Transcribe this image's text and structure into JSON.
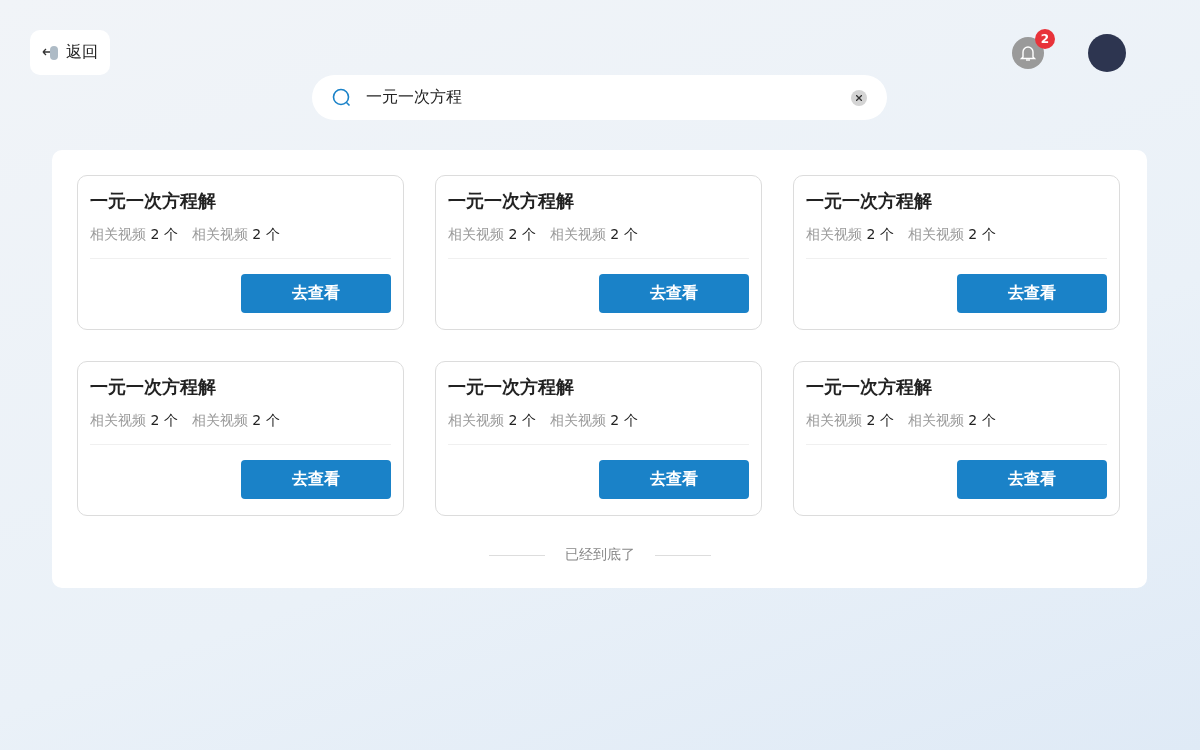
{
  "back_button": {
    "label": "返回"
  },
  "notifications": {
    "badge": "2"
  },
  "search": {
    "value": "一元一次方程"
  },
  "cards": [
    {
      "title": "一元一次方程解",
      "stats": [
        {
          "label": "相关视频",
          "count": "2 个"
        },
        {
          "label": "相关视频",
          "count": "2 个"
        }
      ],
      "button": "去查看"
    },
    {
      "title": "一元一次方程解",
      "stats": [
        {
          "label": "相关视频",
          "count": "2 个"
        },
        {
          "label": "相关视频",
          "count": "2 个"
        }
      ],
      "button": "去查看"
    },
    {
      "title": "一元一次方程解",
      "stats": [
        {
          "label": "相关视频",
          "count": "2 个"
        },
        {
          "label": "相关视频",
          "count": "2 个"
        }
      ],
      "button": "去查看"
    },
    {
      "title": "一元一次方程解",
      "stats": [
        {
          "label": "相关视频",
          "count": "2 个"
        },
        {
          "label": "相关视频",
          "count": "2 个"
        }
      ],
      "button": "去查看"
    },
    {
      "title": "一元一次方程解",
      "stats": [
        {
          "label": "相关视频",
          "count": "2 个"
        },
        {
          "label": "相关视频",
          "count": "2 个"
        }
      ],
      "button": "去查看"
    },
    {
      "title": "一元一次方程解",
      "stats": [
        {
          "label": "相关视频",
          "count": "2 个"
        },
        {
          "label": "相关视频",
          "count": "2 个"
        }
      ],
      "button": "去查看"
    }
  ],
  "end_text": "已经到底了"
}
